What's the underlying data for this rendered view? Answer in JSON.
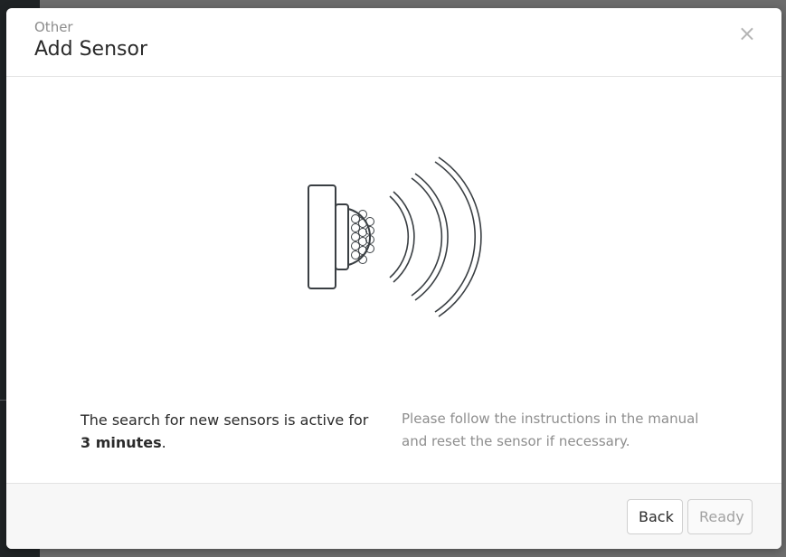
{
  "modal": {
    "subtitle": "Other",
    "title": "Add Sensor",
    "close_label": "×"
  },
  "content": {
    "status_text_prefix": "The search for new sensors is active for ",
    "status_duration": "3 minutes",
    "status_text_suffix": ".",
    "instructions": "Please follow the instructions in the manual and reset the sensor if necessary."
  },
  "footer": {
    "back_label": "Back",
    "ready_label": "Ready"
  },
  "colors": {
    "line": "#3a3f43",
    "subtitle": "#8d8d8d",
    "muted_text": "#8e8e8e"
  }
}
